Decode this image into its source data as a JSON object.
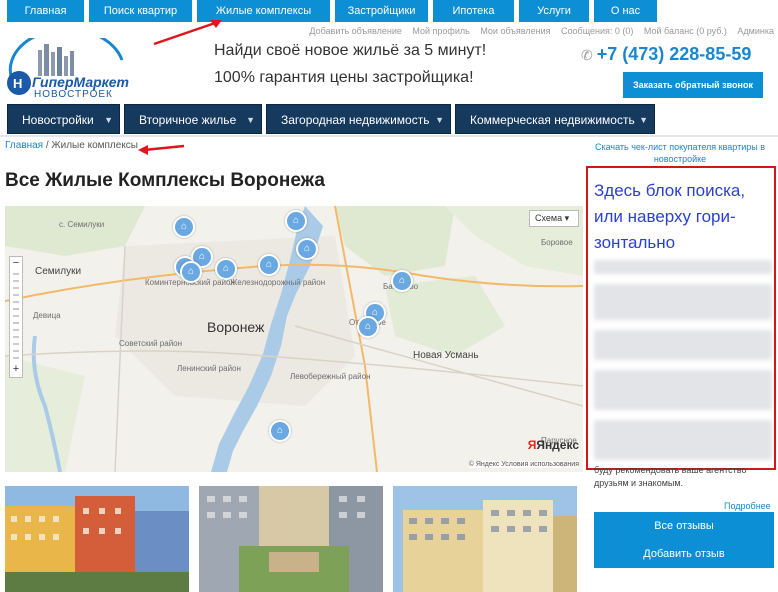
{
  "top_nav": [
    {
      "label": "Главная"
    },
    {
      "label": "Поиск квартир"
    },
    {
      "label": "Жилые комплексы"
    },
    {
      "label": "Застройщики"
    },
    {
      "label": "Ипотека"
    },
    {
      "label": "Услуги"
    },
    {
      "label": "О нас"
    }
  ],
  "user_bar": {
    "add_listing": "Добавить объявление",
    "profile": "Мой профиль",
    "my_listings": "Мои объявления",
    "messages": "Сообщения: 0 (0)",
    "balance": "Мой баланс (0 руб.)",
    "admin": "Админка"
  },
  "logo": {
    "line1": "ГиперМаркет",
    "line2": "новостроек"
  },
  "tagline": {
    "line1": "Найди своё новое жильё за 5 минут!",
    "line2": "100% гарантия цены застройщика!"
  },
  "phone": "+7 (473) 228-85-59",
  "callback_button": "Заказать обратный звонок",
  "category_nav": [
    {
      "label": "Новостройки"
    },
    {
      "label": "Вторичное жилье"
    },
    {
      "label": "Загородная недвижимость"
    },
    {
      "label": "Коммерческая недвижимость"
    }
  ],
  "breadcrumb": {
    "home": "Главная",
    "separator": " / ",
    "current": "Жилые комплексы"
  },
  "checklist_link": "Скачать чек-лист покупателя квартиры в новостройке",
  "page_title": "Все Жилые Комплексы Воронежа",
  "map": {
    "mode_button": "Схема",
    "labels": [
      {
        "text": "с. Семилуки"
      },
      {
        "text": "Семилуки"
      },
      {
        "text": "Коминтерновский район"
      },
      {
        "text": "Железнодорожный район"
      },
      {
        "text": "Воронеж"
      },
      {
        "text": "Советский район"
      },
      {
        "text": "Ленинский район"
      },
      {
        "text": "Левобережный район"
      },
      {
        "text": "Новая Усмань"
      },
      {
        "text": "Бабяково"
      },
      {
        "text": "Отрадное"
      },
      {
        "text": "Парусное"
      },
      {
        "text": "Боровое"
      },
      {
        "text": "Девица"
      }
    ],
    "brand": "Яндекс",
    "copyright": "© Яндекс  Условия использования"
  },
  "search_block": {
    "text": "Здесь блок поиска, или наверху гори-зонтально"
  },
  "review": {
    "text": "буду рекомендовать ваше агентство друзьям и знакомым.",
    "more_link": "Подробнее"
  },
  "buttons": {
    "all_reviews": "Все отзывы",
    "add_review": "Добавить отзыв"
  },
  "colors": {
    "accent": "#0d8fd6",
    "nav_dark": "#16395e",
    "highlight_border": "#d11717",
    "highlight_text": "#2a3fd8"
  }
}
